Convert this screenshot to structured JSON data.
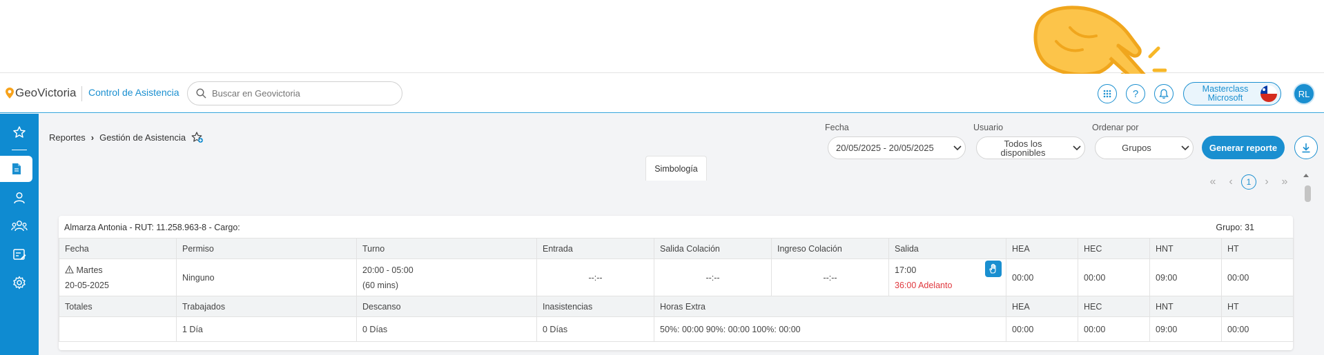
{
  "header": {
    "logo_text": "GeoVictoria",
    "module": "Control de Asistencia",
    "search_placeholder": "Buscar en Geovictoria",
    "profile_line1": "Masterclass",
    "profile_line2": "Microsoft",
    "avatar_initials": "RL"
  },
  "breadcrumb": {
    "root": "Reportes",
    "current": "Gestión de Asistencia"
  },
  "filters": {
    "fecha_label": "Fecha",
    "fecha_value": "20/05/2025 - 20/05/2025",
    "usuario_label": "Usuario",
    "usuario_value_line1": "Todos los",
    "usuario_value_line2": "disponibles",
    "orden_label": "Ordenar por",
    "orden_value": "Grupos",
    "generate_label": "Generar reporte"
  },
  "pager": {
    "first": "«",
    "prev": "‹",
    "page": "1",
    "next": "›",
    "last": "»"
  },
  "simbologia_label": "Simbología",
  "card": {
    "employee": "Almarza Antonia - RUT: 11.258.963-8 - Cargo:",
    "group": "Grupo: 31",
    "columns": [
      "Fecha",
      "Permiso",
      "Turno",
      "Entrada",
      "Salida Colación",
      "Ingreso Colación",
      "Salida",
      "HEA",
      "HEC",
      "HNT",
      "HT"
    ],
    "row": {
      "day": "Martes",
      "date": "20-05-2025",
      "permiso": "Ninguno",
      "turno": "20:00 - 05:00",
      "turno_extra": "(60 mins)",
      "entrada": "--:--",
      "salida_colacion": "--:--",
      "ingreso_colacion": "--:--",
      "salida": "17:00",
      "salida_note": "36:00 Adelanto",
      "hea": "00:00",
      "hec": "00:00",
      "hnt": "09:00",
      "ht": "00:00"
    },
    "totals_columns": [
      "Totales",
      "Trabajados",
      "Descanso",
      "Inasistencias",
      "Horas Extra",
      "HEA",
      "HEC",
      "HNT",
      "HT"
    ],
    "totals": {
      "trabajados": "1 Día",
      "descanso": "0 Días",
      "inasistencias": "0 Días",
      "horas_extra": "50%: 00:00 90%: 00:00 100%: 00:00",
      "hea": "00:00",
      "hec": "00:00",
      "hnt": "09:00",
      "ht": "00:00"
    }
  },
  "colors": {
    "accent": "#1a8fd0",
    "sidebar": "#0f8bd1",
    "late": "#e0383e",
    "pointer": "#f7b728"
  }
}
